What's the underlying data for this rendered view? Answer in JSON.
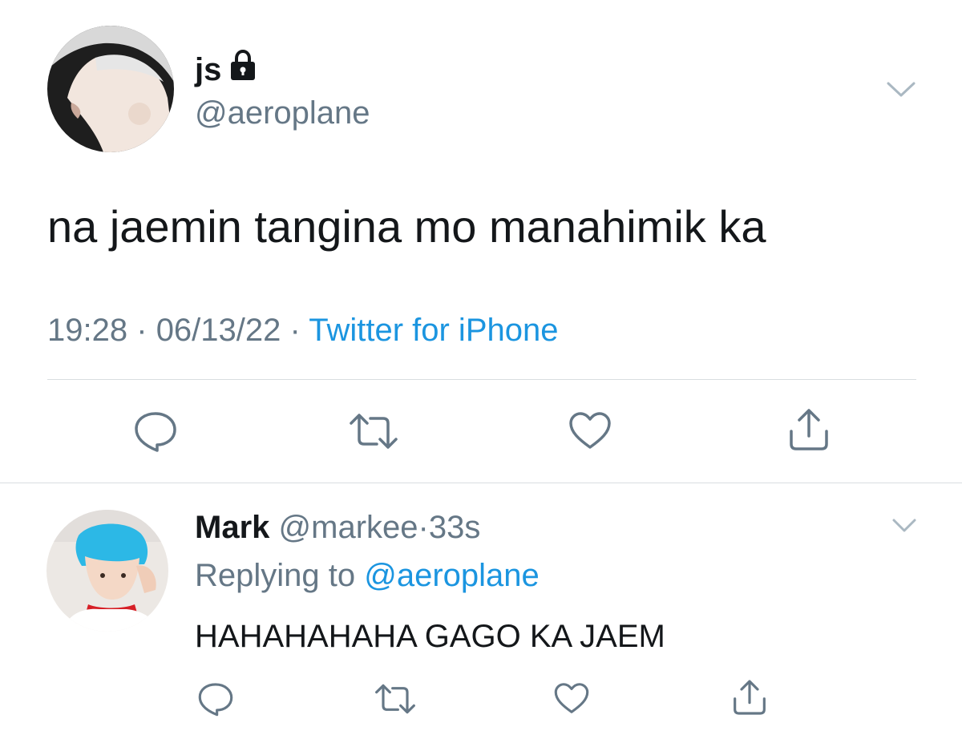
{
  "main_tweet": {
    "display_name": "js",
    "handle": "@aeroplane",
    "text": "na jaemin tangina mo manahimik ka",
    "time": "19:28",
    "date": "06/13/22",
    "source": "Twitter for iPhone",
    "separator": "·",
    "protected_icon": "lock-icon",
    "actions": [
      "reply-icon",
      "retweet-icon",
      "like-icon",
      "share-icon"
    ]
  },
  "reply_tweet": {
    "display_name": "Mark",
    "handle": "@markee",
    "separator": "·",
    "time": "33s",
    "replying_prefix": "Replying to",
    "replying_to": "@aeroplane",
    "text": "HAHAHAHAHA GAGO KA JAEM",
    "actions": [
      "reply-icon",
      "retweet-icon",
      "like-icon",
      "share-icon"
    ]
  },
  "colors": {
    "secondary_text": "#657786",
    "link": "#1b95e0",
    "primary_text": "#14171a",
    "divider": "#d9dde0"
  }
}
